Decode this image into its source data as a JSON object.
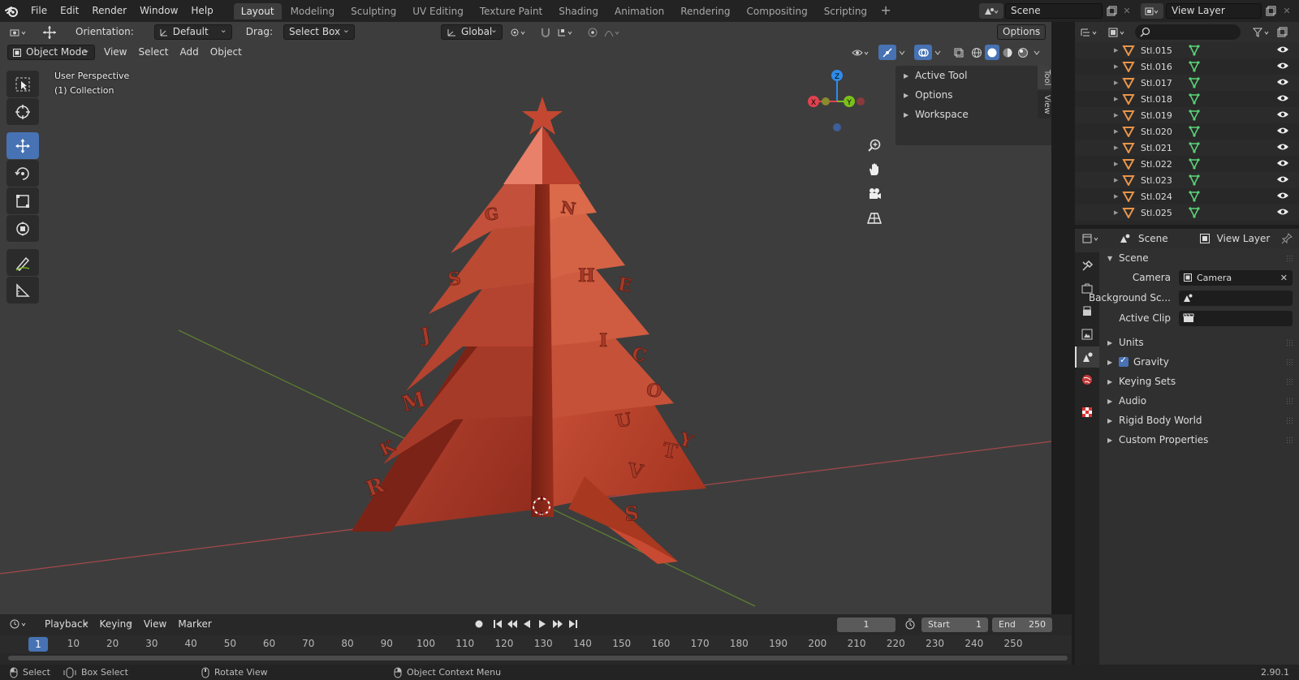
{
  "topbar": {
    "menus": [
      "File",
      "Edit",
      "Render",
      "Window",
      "Help"
    ],
    "workspaces": [
      "Layout",
      "Modeling",
      "Sculpting",
      "UV Editing",
      "Texture Paint",
      "Shading",
      "Animation",
      "Rendering",
      "Compositing",
      "Scripting"
    ],
    "active_workspace": "Layout",
    "add_tab": "+",
    "scene": "Scene",
    "view_layer": "View Layer"
  },
  "viewport": {
    "header1": {
      "orientation_label": "Orientation:",
      "orientation_value": "Default",
      "drag_label": "Drag:",
      "drag_value": "Select Box",
      "transform_orientation": "Global",
      "options": "Options"
    },
    "header2": {
      "mode": "Object Mode",
      "menus": [
        "View",
        "Select",
        "Add",
        "Object"
      ]
    },
    "info": {
      "perspective": "User Perspective",
      "collection": "(1) Collection"
    },
    "gizmo": {
      "x": "X",
      "y": "Y",
      "z": "Z"
    },
    "sidebar": {
      "panels": [
        "Active Tool",
        "Options",
        "Workspace"
      ],
      "tabs": [
        "Tool",
        "View"
      ]
    },
    "tools": [
      "select-box",
      "cursor",
      "move",
      "rotate",
      "scale",
      "transform",
      "annotate",
      "measure"
    ],
    "active_tool": "move",
    "tree_letters": [
      {
        "ch": "R"
      },
      {
        "ch": "M"
      },
      {
        "ch": "J"
      },
      {
        "ch": "S"
      },
      {
        "ch": "G"
      },
      {
        "ch": "N"
      },
      {
        "ch": "H"
      },
      {
        "ch": "E"
      },
      {
        "ch": "I"
      },
      {
        "ch": "C"
      },
      {
        "ch": "O"
      },
      {
        "ch": "U"
      },
      {
        "ch": "T"
      },
      {
        "ch": "Y"
      },
      {
        "ch": "V"
      },
      {
        "ch": "S"
      },
      {
        "ch": "K"
      }
    ]
  },
  "timeline": {
    "menus": [
      "Playback",
      "Keying",
      "View",
      "Marker"
    ],
    "current_frame": "1",
    "start_label": "Start",
    "start": "1",
    "end_label": "End",
    "end": "250",
    "ticks": [
      "10",
      "20",
      "30",
      "40",
      "50",
      "60",
      "70",
      "80",
      "90",
      "100",
      "110",
      "120",
      "130",
      "140",
      "150",
      "160",
      "170",
      "180",
      "190",
      "200",
      "210",
      "220",
      "230",
      "240",
      "250"
    ],
    "playhead": "1"
  },
  "statusbar": {
    "select": "Select",
    "box_select": "Box Select",
    "rotate_view": "Rotate View",
    "context_menu": "Object Context Menu",
    "version": "2.90.1"
  },
  "outliner": {
    "search_placeholder": "",
    "rows": [
      "Stl.015",
      "Stl.016",
      "Stl.017",
      "Stl.018",
      "Stl.019",
      "Stl.020",
      "Stl.021",
      "Stl.022",
      "Stl.023",
      "Stl.024",
      "Stl.025"
    ]
  },
  "properties": {
    "header_scene": "Scene",
    "header_view_layer": "View Layer",
    "section": "Scene",
    "camera_label": "Camera",
    "camera_value": "Camera",
    "background_label": "Background Sc...",
    "background_value": "",
    "clip_label": "Active Clip",
    "clip_value": "",
    "subpanels": [
      "Units",
      "Gravity",
      "Keying Sets",
      "Audio",
      "Rigid Body World",
      "Custom Properties"
    ]
  },
  "colors": {
    "accent": "#4772b3",
    "viewport_bg": "#3d3d3d",
    "tree_red": "#b8402c",
    "axis_x": "#e0424f",
    "axis_y": "#7bbf1a",
    "axis_z": "#2f8ce9",
    "object_orange": "#e8944a",
    "mesh_green": "#5ad177"
  }
}
